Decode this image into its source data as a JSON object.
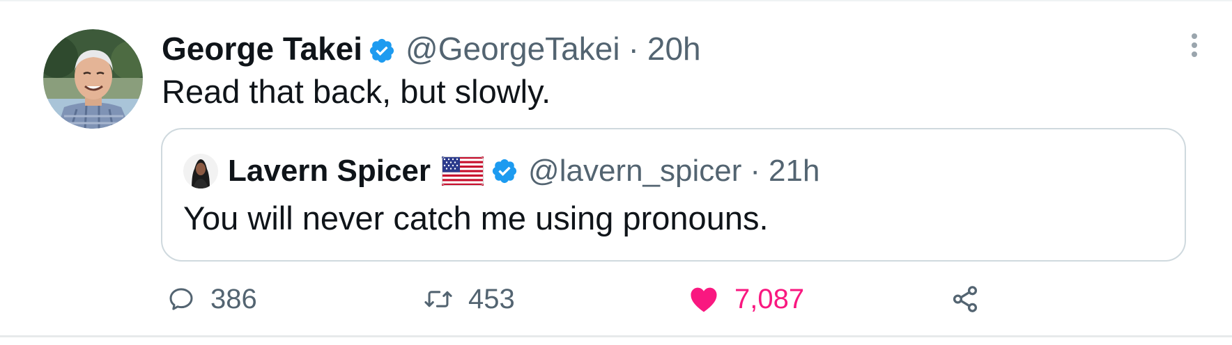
{
  "tweet": {
    "author_name": "George Takei",
    "author_handle": "@GeorgeTakei",
    "separator": "·",
    "time": "20h",
    "text": "Read that back, but slowly.",
    "verified_icon": "verified-badge-icon",
    "more_icon": "more-vertical-icon"
  },
  "quoted_tweet": {
    "author_name": "Lavern Spicer",
    "author_handle": "@lavern_spicer",
    "separator": "·",
    "time": "21h",
    "text": "You will never catch me using pronouns.",
    "flag_icon": "us-flag-icon",
    "verified_icon": "verified-badge-icon"
  },
  "actions": {
    "replies": "386",
    "retweets": "453",
    "likes": "7,087",
    "liked": true
  },
  "colors": {
    "verified": "#1d9bf0",
    "like": "#f91880",
    "muted_text": "#536471",
    "border": "#cfd9de"
  }
}
